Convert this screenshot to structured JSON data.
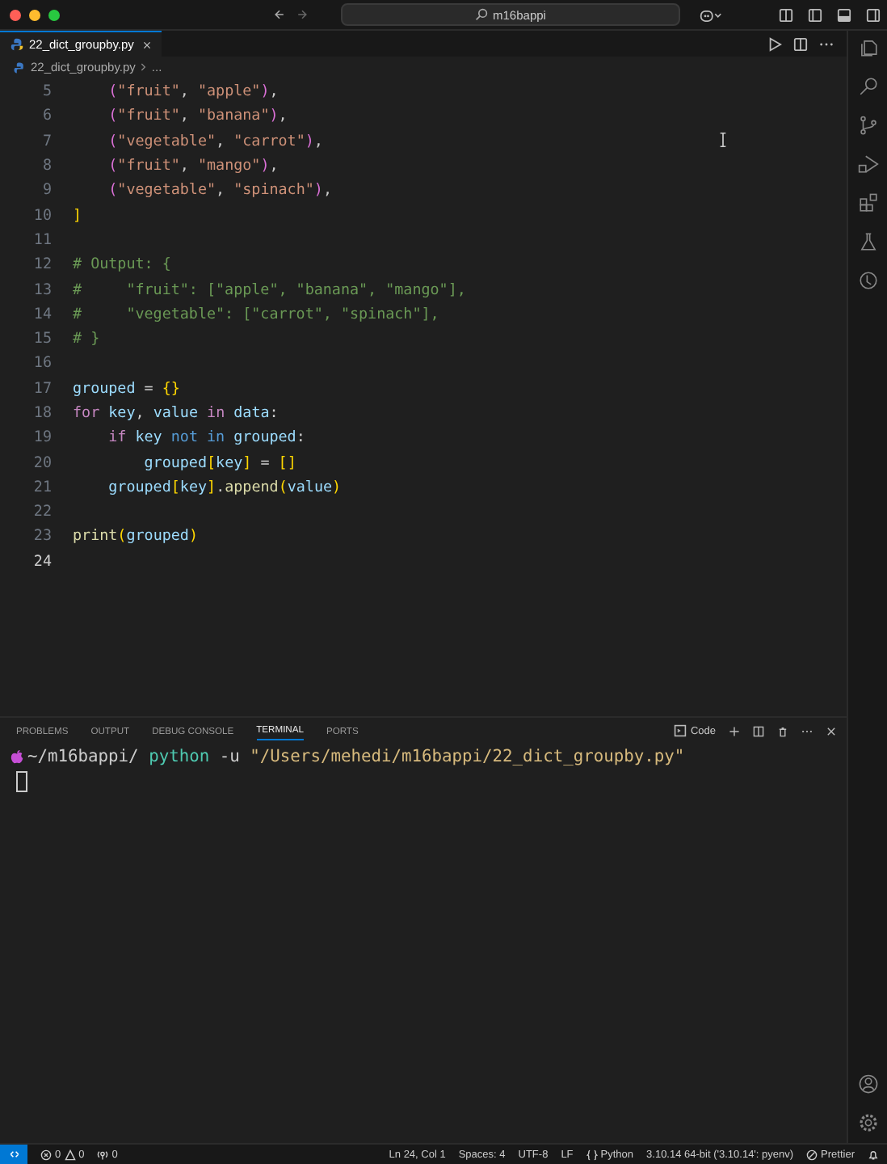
{
  "window": {
    "search": "m16bappi"
  },
  "tabs": [
    {
      "label": "22_dict_groupby.py",
      "selected": true
    }
  ],
  "breadcrumbs": [
    "22_dict_groupby.py",
    "..."
  ],
  "editor": {
    "lines": [
      {
        "number": "5",
        "current": false,
        "tokens": [
          {
            "t": "    (",
            "kind": "paren"
          },
          {
            "t": "\"fruit\"",
            "kind": "string"
          },
          {
            "t": ", ",
            "kind": "plain"
          },
          {
            "t": "\"apple\"",
            "kind": "string"
          },
          {
            "t": ")",
            "kind": "paren"
          },
          {
            "t": ",",
            "kind": "plain"
          }
        ]
      },
      {
        "number": "6",
        "current": false,
        "tokens": [
          {
            "t": "    (",
            "kind": "paren"
          },
          {
            "t": "\"fruit\"",
            "kind": "string"
          },
          {
            "t": ", ",
            "kind": "plain"
          },
          {
            "t": "\"banana\"",
            "kind": "string"
          },
          {
            "t": ")",
            "kind": "paren"
          },
          {
            "t": ",",
            "kind": "plain"
          }
        ]
      },
      {
        "number": "7",
        "current": false,
        "tokens": [
          {
            "t": "    (",
            "kind": "paren"
          },
          {
            "t": "\"vegetable\"",
            "kind": "string"
          },
          {
            "t": ", ",
            "kind": "plain"
          },
          {
            "t": "\"carrot\"",
            "kind": "string"
          },
          {
            "t": ")",
            "kind": "paren"
          },
          {
            "t": ",",
            "kind": "plain"
          }
        ]
      },
      {
        "number": "8",
        "current": false,
        "tokens": [
          {
            "t": "    (",
            "kind": "paren"
          },
          {
            "t": "\"fruit\"",
            "kind": "string"
          },
          {
            "t": ", ",
            "kind": "plain"
          },
          {
            "t": "\"mango\"",
            "kind": "string"
          },
          {
            "t": ")",
            "kind": "paren"
          },
          {
            "t": ",",
            "kind": "plain"
          }
        ]
      },
      {
        "number": "9",
        "current": false,
        "tokens": [
          {
            "t": "    (",
            "kind": "paren"
          },
          {
            "t": "\"vegetable\"",
            "kind": "string"
          },
          {
            "t": ", ",
            "kind": "plain"
          },
          {
            "t": "\"spinach\"",
            "kind": "string"
          },
          {
            "t": ")",
            "kind": "paren"
          },
          {
            "t": ",",
            "kind": "plain"
          }
        ]
      },
      {
        "number": "10",
        "current": false,
        "tokens": [
          {
            "t": "]",
            "kind": "bracket"
          }
        ]
      },
      {
        "number": "11",
        "current": false
      },
      {
        "number": "12",
        "current": false,
        "tokens": [
          {
            "t": "# Output: {",
            "kind": "comment"
          }
        ]
      },
      {
        "number": "13",
        "current": false,
        "tokens": [
          {
            "t": "#     \"fruit\": [\"apple\", \"banana\", \"mango\"],",
            "kind": "comment"
          }
        ]
      },
      {
        "number": "14",
        "current": false,
        "tokens": [
          {
            "t": "#     \"vegetable\": [\"carrot\", \"spinach\"],",
            "kind": "comment"
          }
        ]
      },
      {
        "number": "15",
        "current": false,
        "tokens": [
          {
            "t": "# }",
            "kind": "comment"
          }
        ]
      },
      {
        "number": "16",
        "current": false
      },
      {
        "number": "17",
        "current": false,
        "tokens": [
          {
            "t": "grouped",
            "kind": "var"
          },
          {
            "t": " = ",
            "kind": "plain"
          },
          {
            "t": "{}",
            "kind": "bracket"
          }
        ]
      },
      {
        "number": "18",
        "current": false,
        "tokens": [
          {
            "t": "for",
            "kind": "keyword"
          },
          {
            "t": " key",
            "kind": "var"
          },
          {
            "t": ", ",
            "kind": "plain"
          },
          {
            "t": "value ",
            "kind": "var"
          },
          {
            "t": "in ",
            "kind": "keyword"
          },
          {
            "t": "data",
            "kind": "var"
          },
          {
            "t": ":",
            "kind": "plain"
          }
        ]
      },
      {
        "number": "19",
        "current": false,
        "tokens": [
          {
            "t": "    if",
            "kind": "keyword"
          },
          {
            "t": " key ",
            "kind": "var"
          },
          {
            "t": "not in ",
            "kind": "operator"
          },
          {
            "t": "grouped",
            "kind": "var"
          },
          {
            "t": ":",
            "kind": "plain"
          }
        ]
      },
      {
        "number": "20",
        "current": false,
        "tokens": [
          {
            "t": "        grouped",
            "kind": "var"
          },
          {
            "t": "[",
            "kind": "bracket"
          },
          {
            "t": "key",
            "kind": "var"
          },
          {
            "t": "]",
            "kind": "bracket"
          },
          {
            "t": " = ",
            "kind": "plain"
          },
          {
            "t": "[]",
            "kind": "bracket"
          }
        ]
      },
      {
        "number": "21",
        "current": false,
        "tokens": [
          {
            "t": "    grouped",
            "kind": "var"
          },
          {
            "t": "[",
            "kind": "bracket"
          },
          {
            "t": "key",
            "kind": "var"
          },
          {
            "t": "]",
            "kind": "bracket"
          },
          {
            "t": ".",
            "kind": "plain"
          },
          {
            "t": "append",
            "kind": "func"
          },
          {
            "t": "(",
            "kind": "bracket"
          },
          {
            "t": "value",
            "kind": "var"
          },
          {
            "t": ")",
            "kind": "bracket"
          }
        ]
      },
      {
        "number": "22",
        "current": false
      },
      {
        "number": "23",
        "current": false,
        "tokens": [
          {
            "t": "print",
            "kind": "func"
          },
          {
            "t": "(",
            "kind": "bracket"
          },
          {
            "t": "grouped",
            "kind": "var"
          },
          {
            "t": ")",
            "kind": "bracket"
          }
        ]
      },
      {
        "number": "24",
        "current": true
      }
    ]
  },
  "panel": {
    "tabs": [
      {
        "label": "PROBLEMS",
        "selected": false
      },
      {
        "label": "OUTPUT",
        "selected": false
      },
      {
        "label": "DEBUG CONSOLE",
        "selected": false
      },
      {
        "label": "TERMINAL",
        "selected": true
      },
      {
        "label": "PORTS",
        "selected": false
      }
    ],
    "terminal_name": "Code",
    "command": [
      {
        "t": "~/m16bappi/",
        "kind": "plain"
      },
      {
        "t": " python",
        "kind": "cmd"
      },
      {
        "t": " -u ",
        "kind": "plain"
      },
      {
        "t": "\"/Users/mehedi/m16bappi/22_dict_groupby.py\"",
        "kind": "arg"
      }
    ]
  },
  "status_bar": {
    "errors": "0",
    "warnings": "0",
    "ports": "0",
    "items": [
      "Ln 24, Col 1",
      "Spaces: 4",
      "UTF-8",
      "LF",
      "Python",
      "3.10.14 64-bit ('3.10.14': pyenv)",
      "Prettier"
    ]
  }
}
